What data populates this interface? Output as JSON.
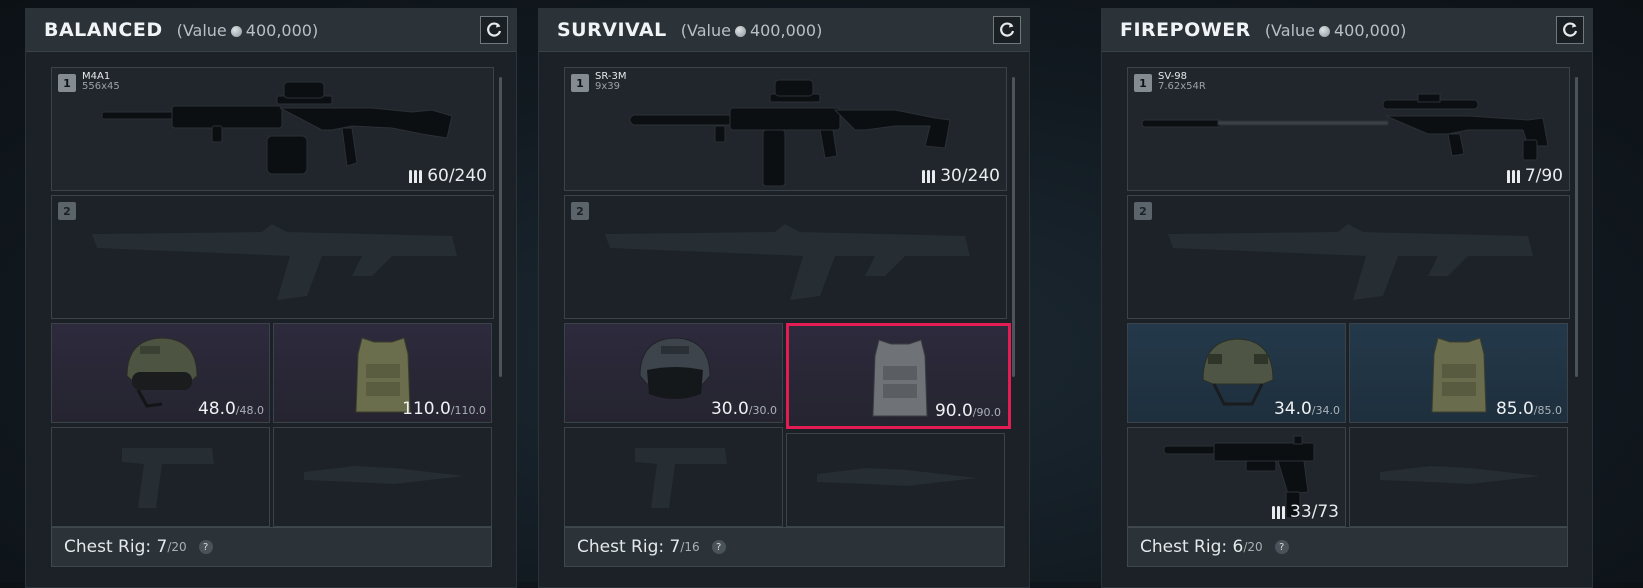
{
  "colors": {
    "highlight": "#e11d53",
    "panel_bg": "#1b2127",
    "header_bg": "#2b3238"
  },
  "presets": [
    {
      "name": "BALANCED",
      "value_label": "(Value",
      "value_amount": "400,000)",
      "primary": {
        "slot": "1",
        "name": "M4A1",
        "caliber": "556x45",
        "ammo": "60/240"
      },
      "secondary": {
        "slot": "2"
      },
      "helmet": {
        "durability": "48.0",
        "max": "/48.0"
      },
      "armor": {
        "durability": "110.0",
        "max": "/110.0"
      },
      "sidearm": {
        "ammo": ""
      },
      "chest_rig": {
        "label": "Chest Rig:",
        "used": "7",
        "cap": "/20",
        "help": "?"
      }
    },
    {
      "name": "SURVIVAL",
      "value_label": "(Value",
      "value_amount": "400,000)",
      "primary": {
        "slot": "1",
        "name": "SR-3M",
        "caliber": "9x39",
        "ammo": "30/240"
      },
      "secondary": {
        "slot": "2"
      },
      "helmet": {
        "durability": "30.0",
        "max": "/30.0"
      },
      "armor": {
        "durability": "90.0",
        "max": "/90.0"
      },
      "sidearm": {
        "ammo": ""
      },
      "chest_rig": {
        "label": "Chest Rig:",
        "used": "7",
        "cap": "/16",
        "help": "?"
      }
    },
    {
      "name": "FIREPOWER",
      "value_label": "(Value",
      "value_amount": "400,000)",
      "primary": {
        "slot": "1",
        "name": "SV-98",
        "caliber": "7.62x54R",
        "ammo": "7/90"
      },
      "secondary": {
        "slot": "2"
      },
      "helmet": {
        "durability": "34.0",
        "max": "/34.0"
      },
      "armor": {
        "durability": "85.0",
        "max": "/85.0"
      },
      "sidearm": {
        "ammo": "33/73"
      },
      "chest_rig": {
        "label": "Chest Rig:",
        "used": "6",
        "cap": "/20",
        "help": "?"
      }
    }
  ]
}
